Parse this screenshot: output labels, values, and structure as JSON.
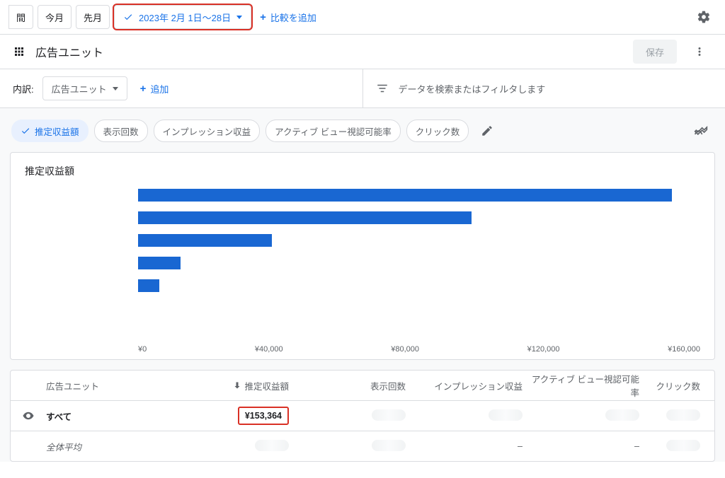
{
  "topbar": {
    "truncated_label": "間",
    "this_month": "今月",
    "last_month": "先月",
    "date_range": "2023年 2月 1日～28日",
    "add_compare": "比較を追加"
  },
  "page": {
    "title": "広告ユニット",
    "save": "保存"
  },
  "filter": {
    "label": "内訳:",
    "dropdown": "広告ユニット",
    "add": "追加",
    "search_placeholder": "データを検索またはフィルタします"
  },
  "metrics": [
    "推定収益額",
    "表示回数",
    "インプレッション収益",
    "アクティブ ビュー視認可能率",
    "クリック数"
  ],
  "chart_data": {
    "type": "bar",
    "orientation": "horizontal",
    "title": "推定収益額",
    "xlabel": "",
    "ylabel": "",
    "xlim": [
      0,
      160000
    ],
    "x_ticks": [
      "¥0",
      "¥40,000",
      "¥80,000",
      "¥120,000",
      "¥160,000"
    ],
    "categories": [
      "",
      "",
      "",
      "",
      ""
    ],
    "values": [
      152000,
      95000,
      38000,
      12000,
      6000
    ]
  },
  "table": {
    "headers": {
      "unit": "広告ユニット",
      "revenue": "推定収益額",
      "impressions": "表示回数",
      "imp_revenue": "インプレッション収益",
      "active_view": "アクティブ ビュー視認可能率",
      "clicks": "クリック数"
    },
    "rows": [
      {
        "name": "すべて",
        "revenue": "¥153,364",
        "highlight": true,
        "bold": true,
        "eye": true
      },
      {
        "name": "全体平均",
        "italic": true,
        "imp_revenue": "–",
        "active_view": "–"
      }
    ]
  }
}
